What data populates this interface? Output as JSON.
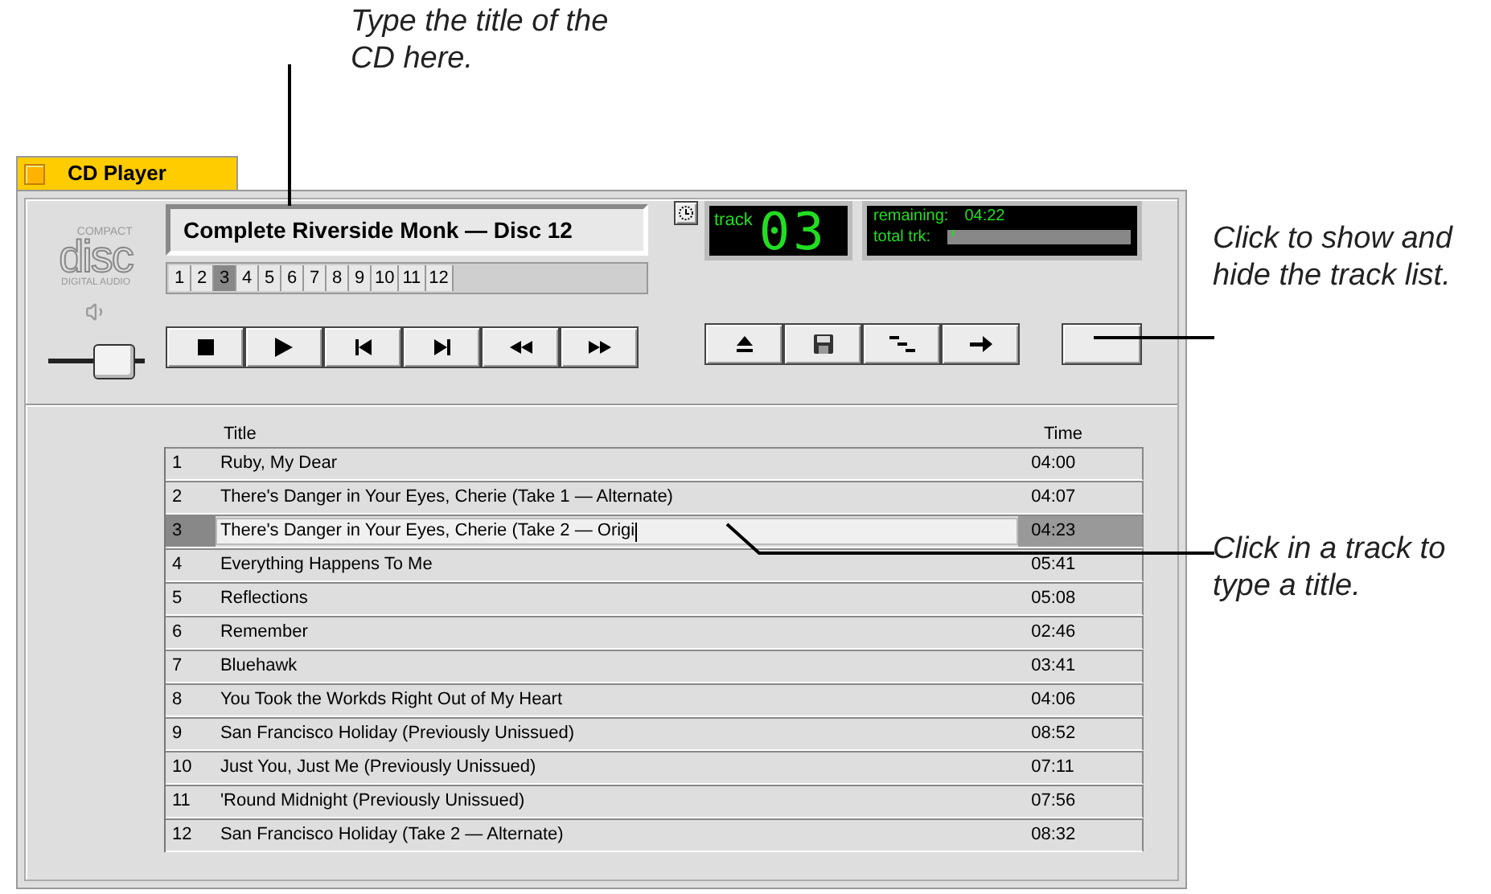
{
  "annotations": [
    {
      "text": "Type the title of the CD here."
    },
    {
      "text": "Click to show and hide the track list."
    },
    {
      "text": "Click in a track to type a title."
    }
  ],
  "window": {
    "title": "CD Player"
  },
  "disc_logo": {
    "top": "COMPACT",
    "main": "disc",
    "bottom": "DIGITAL AUDIO"
  },
  "cd_title": {
    "value": "Complete Riverside Monk — Disc 12"
  },
  "track_buttons": [
    {
      "label": "1",
      "selected": false
    },
    {
      "label": "2",
      "selected": false
    },
    {
      "label": "3",
      "selected": true
    },
    {
      "label": "4",
      "selected": false
    },
    {
      "label": "5",
      "selected": false
    },
    {
      "label": "6",
      "selected": false
    },
    {
      "label": "7",
      "selected": false
    },
    {
      "label": "8",
      "selected": false
    },
    {
      "label": "9",
      "selected": false
    },
    {
      "label": "10",
      "selected": false
    },
    {
      "label": "11",
      "selected": false
    },
    {
      "label": "12",
      "selected": false
    }
  ],
  "volume": {
    "level": 0.85
  },
  "track_display": {
    "label": "track",
    "number": "03"
  },
  "time_display": {
    "remaining_label": "remaining:",
    "remaining": "04:22",
    "total_label": "total trk:",
    "level": 0.03
  },
  "table": {
    "columns": [
      "Title",
      "Time"
    ],
    "rows": [
      {
        "number": "1",
        "title": "Ruby, My Dear",
        "time": "04:00",
        "selected": false
      },
      {
        "number": "2",
        "title": "There's Danger in Your Eyes, Cherie (Take 1 — Alternate)",
        "time": "04:07",
        "selected": false
      },
      {
        "number": "3",
        "title": "There's Danger in Your Eyes, Cherie (Take 2 — Origi",
        "time": "04:23",
        "selected": true
      },
      {
        "number": "4",
        "title": "Everything Happens To Me",
        "time": "05:41",
        "selected": false
      },
      {
        "number": "5",
        "title": "Reflections",
        "time": "05:08",
        "selected": false
      },
      {
        "number": "6",
        "title": "Remember",
        "time": "02:46",
        "selected": false
      },
      {
        "number": "7",
        "title": "Bluehawk",
        "time": "03:41",
        "selected": false
      },
      {
        "number": "8",
        "title": "You Took the Workds Right Out of My Heart",
        "time": "04:06",
        "selected": false
      },
      {
        "number": "9",
        "title": "San Francisco Holiday (Previously Unissued)",
        "time": "08:52",
        "selected": false
      },
      {
        "number": "10",
        "title": "Just You, Just Me (Previously Unissued)",
        "time": "07:11",
        "selected": false
      },
      {
        "number": "11",
        "title": "'Round Midnight (Previously Unissued)",
        "time": "07:56",
        "selected": false
      },
      {
        "number": "12",
        "title": "San Francisco Holiday (Take 2 — Alternate)",
        "time": "08:32",
        "selected": false
      }
    ]
  }
}
